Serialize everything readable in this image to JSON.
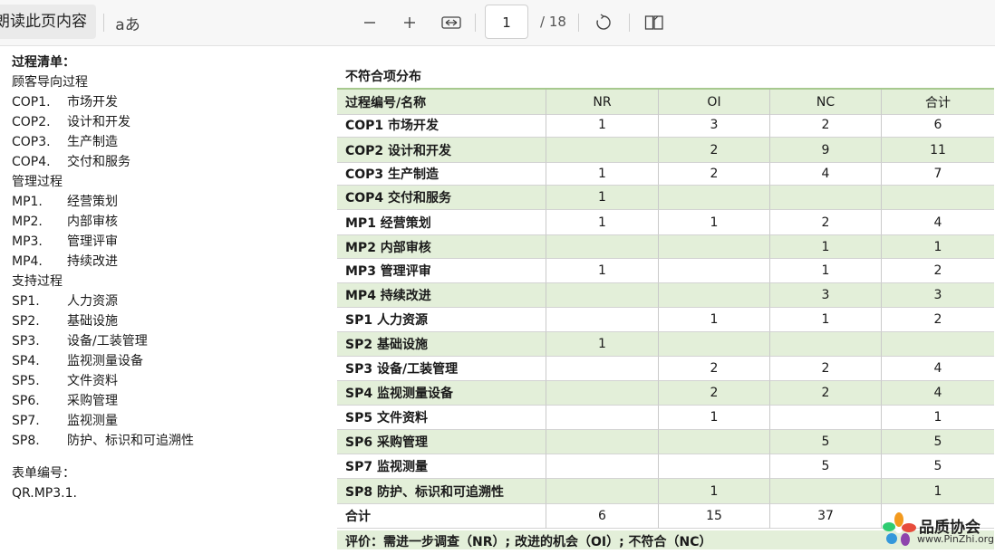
{
  "toolbar": {
    "read_aloud_label": "朗读此页内容",
    "text_options_icon": "aあ",
    "zoom_out_icon": "minus-icon",
    "zoom_in_icon": "plus-icon",
    "fit_width_icon": "fit-width-icon",
    "current_page": "1",
    "total_pages": "/ 18",
    "rotate_icon": "rotate-icon",
    "page_view_icon": "page-view-icon"
  },
  "process_list": {
    "title": "过程清单：",
    "groups": [
      {
        "name": "顾客导向过程",
        "items": [
          {
            "code": "COP1.",
            "name": "市场开发"
          },
          {
            "code": "COP2.",
            "name": "设计和开发"
          },
          {
            "code": "COP3.",
            "name": "生产制造"
          },
          {
            "code": "COP4.",
            "name": "交付和服务"
          }
        ]
      },
      {
        "name": "管理过程",
        "items": [
          {
            "code": "MP1.",
            "name": "经营策划"
          },
          {
            "code": "MP2.",
            "name": "内部审核"
          },
          {
            "code": "MP3.",
            "name": "管理评审"
          },
          {
            "code": "MP4.",
            "name": "持续改进"
          }
        ]
      },
      {
        "name": "支持过程",
        "items": [
          {
            "code": "SP1.",
            "name": "人力资源"
          },
          {
            "code": "SP2.",
            "name": "基础设施"
          },
          {
            "code": "SP3.",
            "name": "设备/工装管理"
          },
          {
            "code": "SP4.",
            "name": "监视测量设备"
          },
          {
            "code": "SP5.",
            "name": "文件资料"
          },
          {
            "code": "SP6.",
            "name": "采购管理"
          },
          {
            "code": "SP7.",
            "name": "监视测量"
          },
          {
            "code": "SP8.",
            "name": "防护、标识和可追溯性"
          }
        ]
      }
    ],
    "form_label": "表单编号：",
    "form_number": "QR.MP3.1."
  },
  "table": {
    "title": "不符合项分布",
    "headers": [
      "过程编号/名称",
      "NR",
      "OI",
      "NC",
      "合计"
    ],
    "rows": [
      [
        "COP1 市场开发",
        "1",
        "3",
        "2",
        "6"
      ],
      [
        "COP2 设计和开发",
        "",
        "2",
        "9",
        "11"
      ],
      [
        "COP3 生产制造",
        "1",
        "2",
        "4",
        "7"
      ],
      [
        "COP4 交付和服务",
        "1",
        "",
        "",
        ""
      ],
      [
        "MP1 经营策划",
        "1",
        "1",
        "2",
        "4"
      ],
      [
        "MP2 内部审核",
        "",
        "",
        "1",
        "1"
      ],
      [
        "MP3 管理评审",
        "1",
        "",
        "1",
        "2"
      ],
      [
        "MP4 持续改进",
        "",
        "",
        "3",
        "3"
      ],
      [
        "SP1 人力资源",
        "",
        "1",
        "1",
        "2"
      ],
      [
        "SP2 基础设施",
        "1",
        "",
        "",
        ""
      ],
      [
        "SP3 设备/工装管理",
        "",
        "2",
        "2",
        "4"
      ],
      [
        "SP4 监视测量设备",
        "",
        "2",
        "2",
        "4"
      ],
      [
        "SP5 文件资料",
        "",
        "1",
        "",
        "1"
      ],
      [
        "SP6 采购管理",
        "",
        "",
        "5",
        "5"
      ],
      [
        "SP7 监视测量",
        "",
        "",
        "5",
        "5"
      ],
      [
        "SP8 防护、标识和可追溯性",
        "",
        "1",
        "",
        "1"
      ],
      [
        "合计",
        "6",
        "15",
        "37",
        ""
      ]
    ],
    "evaluation": "评价：需进一步调查（NR）; 改进的机会（OI）; 不符合（NC）"
  },
  "watermark": {
    "name": "品质协会",
    "url": "www.PinZhi.org"
  },
  "colors": {
    "table_alt_row": "#e3efd9",
    "table_header_border": "#a7c98f"
  }
}
